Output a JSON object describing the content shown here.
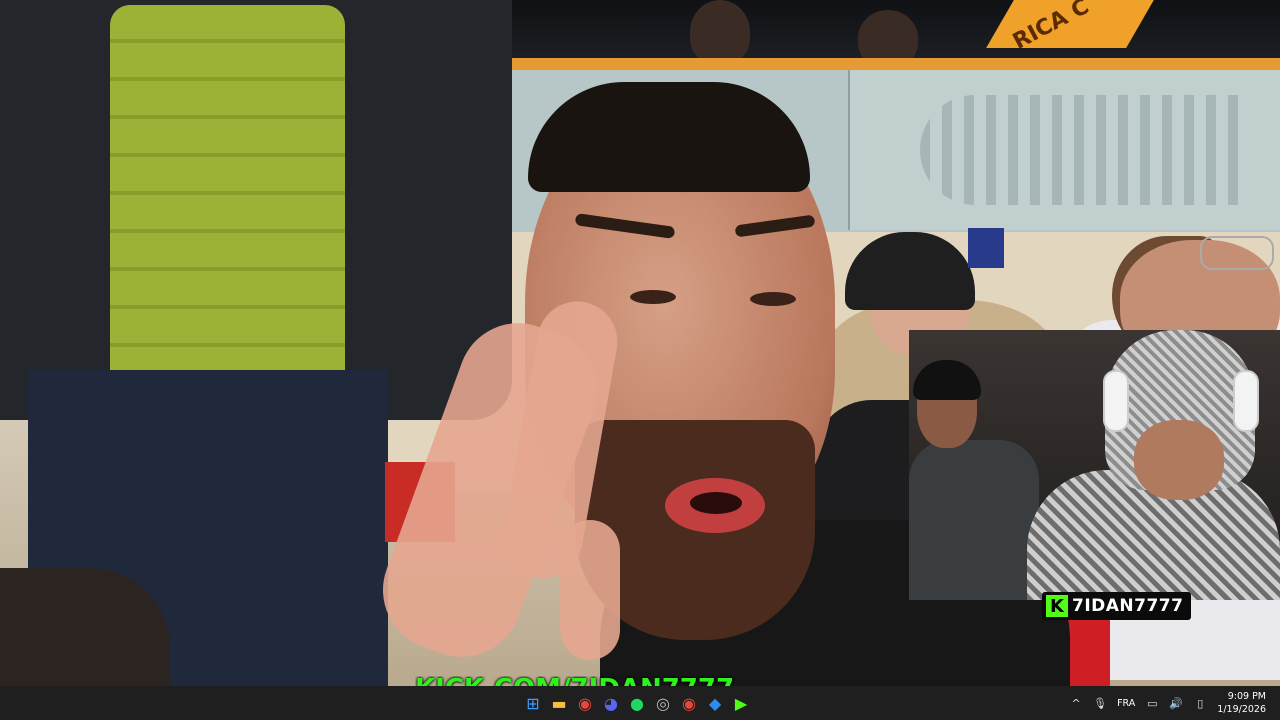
{
  "video": {
    "background_banner_text": "RICA C",
    "subtitle_text": "KICK.COM/7IDAN7777",
    "streamer_tag": {
      "logo_letter": "K",
      "name": "7IDAN7777",
      "accent_color": "#53fc18"
    },
    "flag_colors": [
      "#1a9e3a",
      "#f4d21f",
      "#e0202a"
    ]
  },
  "taskbar": {
    "apps": [
      {
        "name": "windows-start-icon",
        "glyph": "⊞",
        "color": "#3aa0ff"
      },
      {
        "name": "file-explorer-icon",
        "glyph": "▬",
        "color": "#f3c03a"
      },
      {
        "name": "chrome-icon",
        "glyph": "◉",
        "color": "#e5473c"
      },
      {
        "name": "discord-icon",
        "glyph": "◕",
        "color": "#5865f2"
      },
      {
        "name": "spotify-icon",
        "glyph": "●",
        "color": "#1ed760"
      },
      {
        "name": "obs-icon",
        "glyph": "◎",
        "color": "#bbbbbb"
      },
      {
        "name": "chrome-alt-icon",
        "glyph": "◉",
        "color": "#e5473c"
      },
      {
        "name": "app-blue-icon",
        "glyph": "◆",
        "color": "#2d8cf0"
      },
      {
        "name": "kick-app-icon",
        "glyph": "▶",
        "color": "#53fc18"
      }
    ],
    "tray": {
      "chevron": "^",
      "mic": "🎙",
      "language": "FRA",
      "network": "▭",
      "volume": "🔊",
      "battery": "▯",
      "time": "9:09 PM",
      "date": "1/19/2026"
    }
  }
}
